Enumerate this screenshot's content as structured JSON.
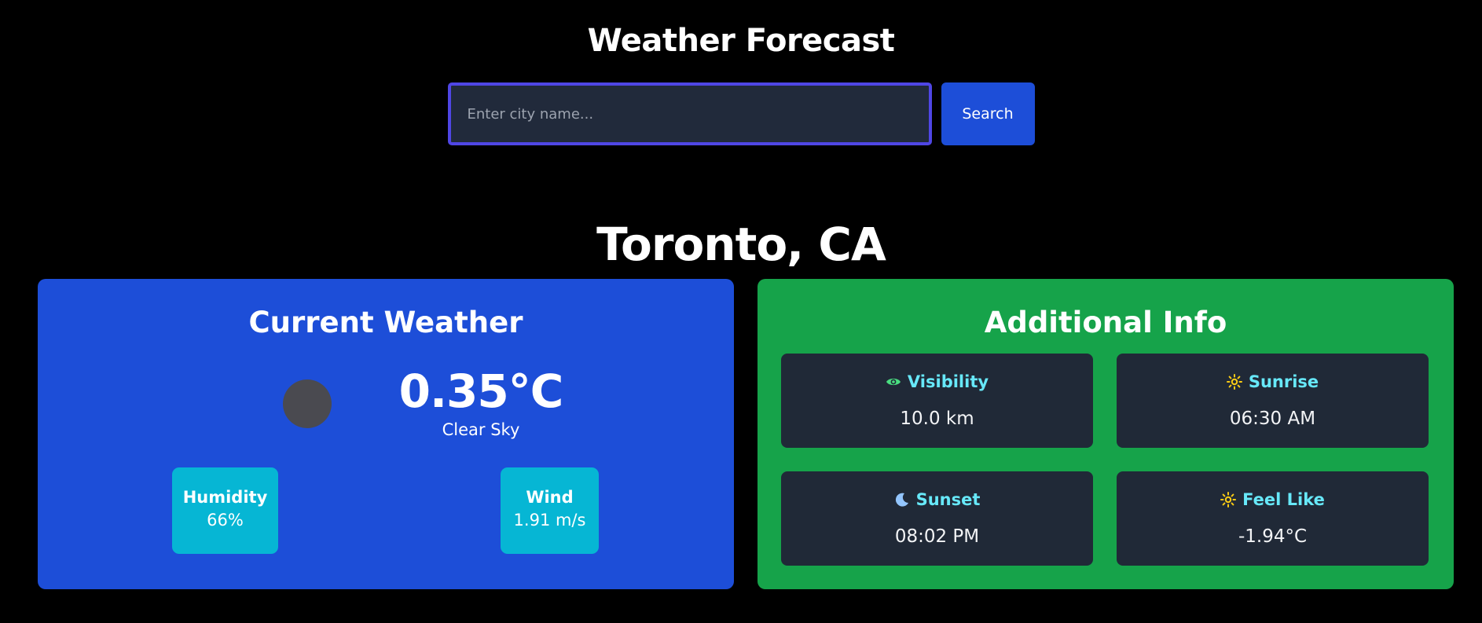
{
  "header": {
    "title": "Weather Forecast"
  },
  "search": {
    "placeholder": "Enter city name...",
    "value": "",
    "button_label": "Search"
  },
  "location": {
    "city": "Toronto, CA"
  },
  "current_weather": {
    "title": "Current Weather",
    "icon": "weather-condition-icon",
    "temperature": "0.35°C",
    "condition": "Clear Sky",
    "humidity": {
      "label": "Humidity",
      "value": "66%"
    },
    "wind": {
      "label": "Wind",
      "value": "1.91 m/s"
    }
  },
  "additional_info": {
    "title": "Additional Info",
    "cards": {
      "visibility": {
        "icon": "eye-icon",
        "label": "Visibility",
        "value": "10.0 km"
      },
      "sunrise": {
        "icon": "sun-icon",
        "label": "Sunrise",
        "value": "06:30 AM"
      },
      "sunset": {
        "icon": "moon-icon",
        "label": "Sunset",
        "value": "08:02 PM"
      },
      "feel_like": {
        "icon": "sun-icon",
        "label": "Feel Like",
        "value": "-1.94°C"
      }
    }
  },
  "colors": {
    "background": "#000000",
    "accent": "#1d4ed8",
    "input_border": "#4f46e5",
    "current_panel": "#1d4ed8",
    "info_panel": "#16a34a",
    "stat_box": "#06b6d4",
    "card_background": "#202937",
    "card_label": "#67e8f9",
    "sun_icon": "#facc15",
    "eye_icon": "#4ade80",
    "moon_icon": "#93c5fd"
  }
}
